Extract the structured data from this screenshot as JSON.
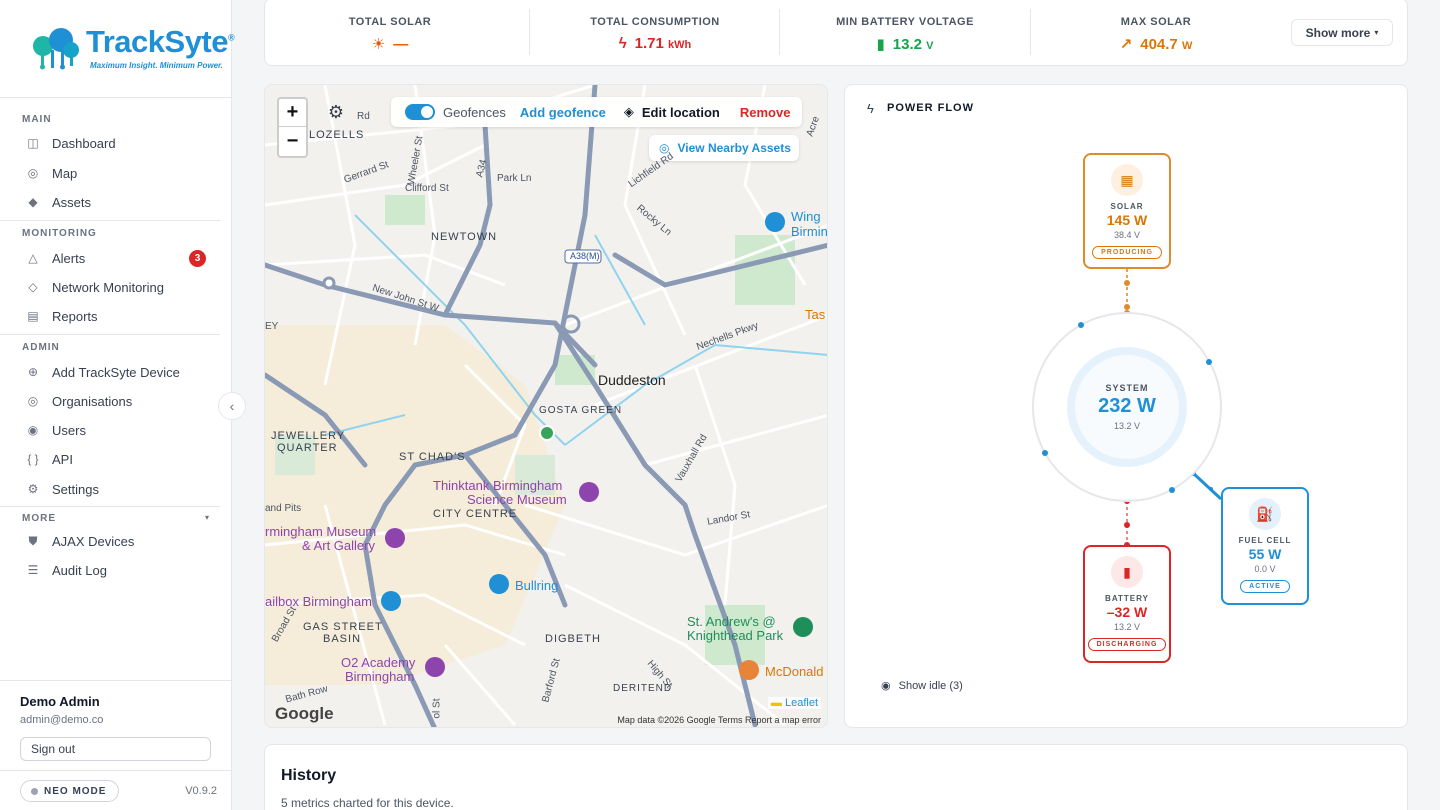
{
  "brand": {
    "name": "TrackSyte",
    "reg": "®",
    "tagline": "Maximum Insight. Minimum Power."
  },
  "sidebar": {
    "sections": {
      "main": "MAIN",
      "monitoring": "MONITORING",
      "admin": "ADMIN",
      "more": "MORE"
    },
    "main_items": [
      {
        "label": "Dashboard",
        "icon": "dashboard-icon"
      },
      {
        "label": "Map",
        "icon": "map-icon"
      },
      {
        "label": "Assets",
        "icon": "assets-icon"
      }
    ],
    "monitoring_items": [
      {
        "label": "Alerts",
        "icon": "alert-icon",
        "badge": "3"
      },
      {
        "label": "Network Monitoring",
        "icon": "network-icon"
      },
      {
        "label": "Reports",
        "icon": "reports-icon"
      }
    ],
    "admin_items": [
      {
        "label": "Add TrackSyte Device",
        "icon": "add-device-icon"
      },
      {
        "label": "Organisations",
        "icon": "organisations-icon"
      },
      {
        "label": "Users",
        "icon": "users-icon"
      },
      {
        "label": "API",
        "icon": "api-icon"
      },
      {
        "label": "Settings",
        "icon": "settings-icon"
      }
    ],
    "more_items": [
      {
        "label": "AJAX Devices",
        "icon": "shield-icon"
      },
      {
        "label": "Audit Log",
        "icon": "list-icon"
      }
    ],
    "user": {
      "name": "Demo Admin",
      "email": "admin@demo.co",
      "signout": "Sign out"
    },
    "mode": "NEO MODE",
    "version": "V0.9.2"
  },
  "stats": [
    {
      "label": "TOTAL SOLAR",
      "value": "—",
      "unit": "",
      "color": "#ea580c"
    },
    {
      "label": "TOTAL CONSUMPTION",
      "value": "1.71",
      "unit": "kWh",
      "color": "#dc2626"
    },
    {
      "label": "MIN BATTERY VOLTAGE",
      "value": "13.2",
      "unit": "V",
      "color": "#16a34a"
    },
    {
      "label": "MAX SOLAR",
      "value": "404.7",
      "unit": "W",
      "color": "#d97706"
    }
  ],
  "show_more": "Show more",
  "map": {
    "geofences_label": "Geofences",
    "add_geofence": "Add geofence",
    "edit_location": "Edit location",
    "remove": "Remove",
    "view_nearby": "View Nearby Assets",
    "zoom_in": "+",
    "zoom_out": "−",
    "labels": {
      "lozells": "LOZELLS",
      "newtown": "NEWTOWN",
      "duddeston": "Duddeston",
      "gosta_green": "GOSTA GREEN",
      "jewellery": "JEWELLERY",
      "quarter": "QUARTER",
      "st_chads": "ST CHAD'S",
      "city_centre": "CITY CENTRE",
      "gas_street": "GAS STREET",
      "basin": "BASIN",
      "digbeth": "DIGBETH",
      "deritend": "DERITEND",
      "thinktank1": "Thinktank Birmingham",
      "thinktank2": "Science Museum",
      "museum1": "rmingham Museum",
      "museum2": "& Art Gallery",
      "mailbox": "ailbox Birmingham",
      "bullring": "Bullring",
      "o2_1": "O2 Academy",
      "o2_2": "Birmingham",
      "standrews1": "St. Andrew's @",
      "standrews2": "Knighthead Park",
      "mcdonalds": "McDonald",
      "wing1": "Wing",
      "wing2": "Birmin",
      "tas": "Tas",
      "a38m": "A38(M)",
      "a34": "A34",
      "gerrard": "Gerrard St",
      "clifford": "Clifford St",
      "park_ln": "Park Ln",
      "wheeler": "Wheeler St",
      "lichfield": "Lichfield Rd",
      "rocky": "Rocky Ln",
      "new_john": "New John St W",
      "nechells": "Nechells Pkwy",
      "vauxhall": "Vauxhall Rd",
      "landor": "Landor St",
      "high_st": "High St",
      "barford": "Barford St",
      "broad": "Broad St",
      "bath_row": "Bath Row",
      "and_pits": "and Pits",
      "ey": "EY",
      "acre": "Acre",
      "rd": "Rd",
      "ol_st": "ol St"
    },
    "google": "Google",
    "leaflet": "Leaflet",
    "attribution": "Map data ©2026 Google   Terms   Report a map error"
  },
  "power": {
    "title": "POWER FLOW",
    "solar": {
      "label": "SOLAR",
      "value": "145 W",
      "sub": "38.4 V",
      "status": "PRODUCING",
      "color": "#d97706"
    },
    "system": {
      "label": "SYSTEM",
      "value": "232 W",
      "sub": "13.2 V",
      "color": "#1f8fd6"
    },
    "battery": {
      "label": "BATTERY",
      "value": "–32 W",
      "sub": "13.2 V",
      "status": "DISCHARGING",
      "color": "#dc2626"
    },
    "fuel_cell": {
      "label": "FUEL CELL",
      "value": "55 W",
      "sub": "0.0 V",
      "status": "ACTIVE",
      "color": "#1f8fd6"
    },
    "show_idle": "Show idle (3)"
  },
  "history": {
    "title": "History",
    "subtitle": "5 metrics charted for this device."
  }
}
